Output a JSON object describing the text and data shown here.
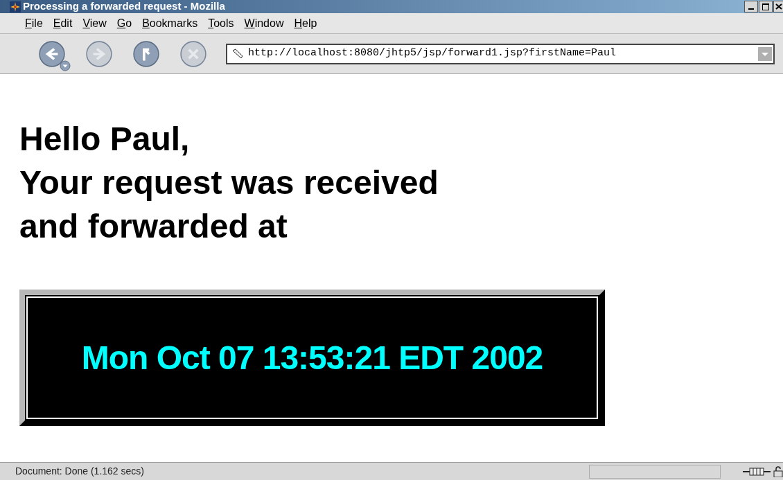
{
  "window": {
    "title": "Processing a forwarded request - Mozilla"
  },
  "menu": [
    {
      "label": "File"
    },
    {
      "label": "Edit"
    },
    {
      "label": "View"
    },
    {
      "label": "Go"
    },
    {
      "label": "Bookmarks"
    },
    {
      "label": "Tools"
    },
    {
      "label": "Window"
    },
    {
      "label": "Help"
    }
  ],
  "toolbar": {
    "buttons": [
      {
        "kind": "back",
        "disabled": false
      },
      {
        "kind": "forward",
        "disabled": true
      },
      {
        "kind": "reload",
        "disabled": false
      },
      {
        "kind": "stop",
        "disabled": true
      }
    ],
    "address": {
      "value": "http://localhost:8080/jhtp5/jsp/forward1.jsp?firstName=Paul"
    }
  },
  "page": {
    "heading_lines": [
      "Hello Paul,",
      "Your request was received",
      "and forwarded at"
    ],
    "timestamp": "Mon Oct 07 13:53:21 EDT 2002"
  },
  "status_bar": {
    "text": "Document: Done (1.162 secs)"
  }
}
